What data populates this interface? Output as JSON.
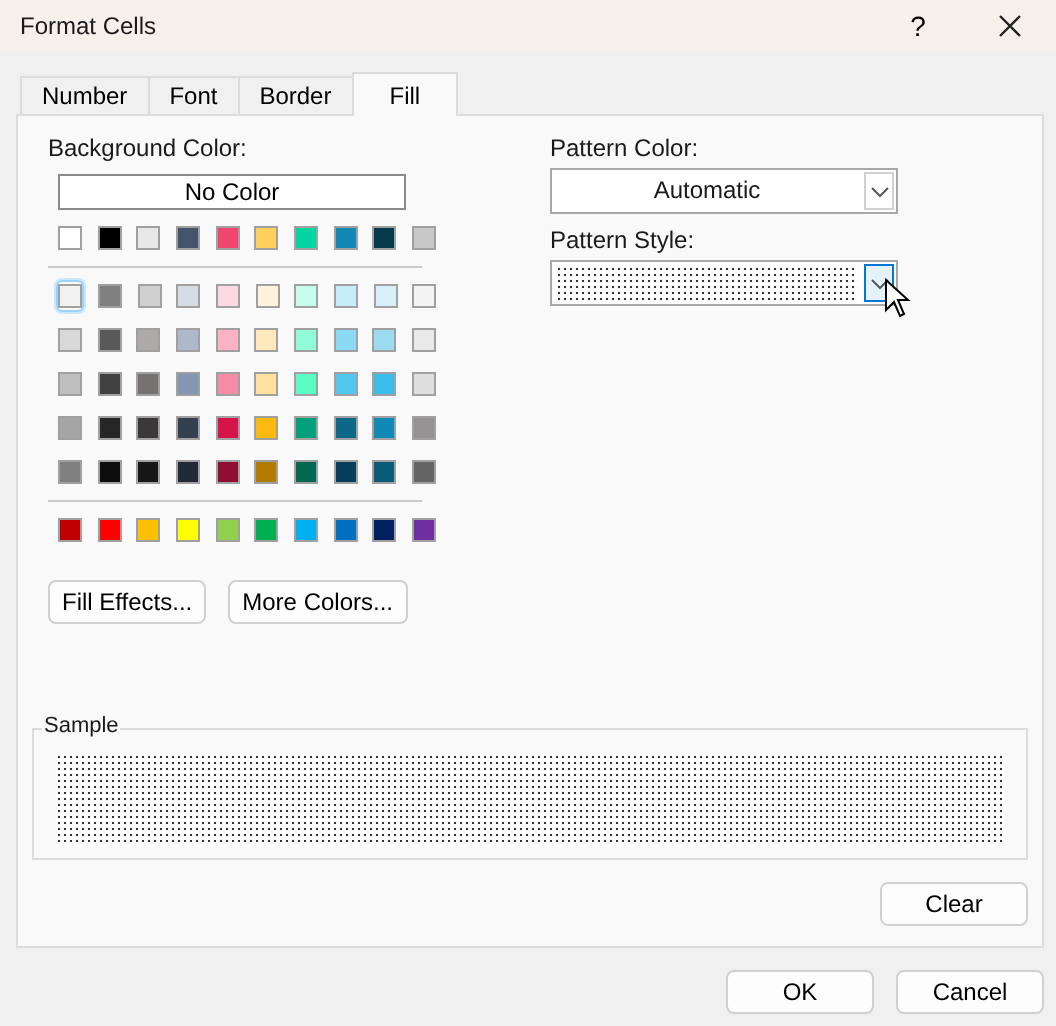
{
  "window": {
    "title": "Format Cells",
    "help_button": "?"
  },
  "tabs": [
    {
      "label": "Number",
      "selected": false
    },
    {
      "label": "Font",
      "selected": false
    },
    {
      "label": "Border",
      "selected": false
    },
    {
      "label": "Fill",
      "selected": true
    }
  ],
  "background_color": {
    "label": "Background Color:",
    "no_color_button": "No Color",
    "theme_colors": [
      {
        "color": "#ffffff",
        "selected": false
      },
      {
        "color": "#000000",
        "selected": false
      },
      {
        "color": "#e8e8e8",
        "selected": false
      },
      {
        "color": "#44546a",
        "selected": false
      },
      {
        "color": "#f0466e",
        "selected": false
      },
      {
        "color": "#ffd05c",
        "selected": false
      },
      {
        "color": "#00d4a0",
        "selected": false
      },
      {
        "color": "#1189b4",
        "selected": false
      },
      {
        "color": "#073a4a",
        "selected": false
      },
      {
        "color": "#c8c8c8",
        "selected": false
      }
    ],
    "shade_rows": [
      [
        {
          "color": "#f2f2f2",
          "selected": true
        },
        {
          "color": "#808080",
          "selected": false
        },
        {
          "color": "#d0d0d0",
          "selected": false
        },
        {
          "color": "#d6dce4",
          "selected": false
        },
        {
          "color": "#fcd9e2",
          "selected": false
        },
        {
          "color": "#fff3dc",
          "selected": false
        },
        {
          "color": "#c8fcec",
          "selected": false
        },
        {
          "color": "#c6edfa",
          "selected": false
        },
        {
          "color": "#d7f0fa",
          "selected": false
        },
        {
          "color": "#f4f4f4",
          "selected": false
        }
      ],
      [
        {
          "color": "#d9d9d9",
          "selected": false
        },
        {
          "color": "#595959",
          "selected": false
        },
        {
          "color": "#aeaaaa",
          "selected": false
        },
        {
          "color": "#adb9ca",
          "selected": false
        },
        {
          "color": "#f9b3c5",
          "selected": false
        },
        {
          "color": "#ffe8bd",
          "selected": false
        },
        {
          "color": "#91fad9",
          "selected": false
        },
        {
          "color": "#8cd9f3",
          "selected": false
        },
        {
          "color": "#9ddbf0",
          "selected": false
        },
        {
          "color": "#e9e9e9",
          "selected": false
        }
      ],
      [
        {
          "color": "#bfbfbf",
          "selected": false
        },
        {
          "color": "#404040",
          "selected": false
        },
        {
          "color": "#767171",
          "selected": false
        },
        {
          "color": "#8497b0",
          "selected": false
        },
        {
          "color": "#f68da8",
          "selected": false
        },
        {
          "color": "#ffe29f",
          "selected": false
        },
        {
          "color": "#5bfdc5",
          "selected": false
        },
        {
          "color": "#51c8ed",
          "selected": false
        },
        {
          "color": "#3cbce9",
          "selected": false
        },
        {
          "color": "#dedede",
          "selected": false
        }
      ],
      [
        {
          "color": "#a6a6a6",
          "selected": false
        },
        {
          "color": "#262626",
          "selected": false
        },
        {
          "color": "#3a3838",
          "selected": false
        },
        {
          "color": "#323f4f",
          "selected": false
        },
        {
          "color": "#d5144a",
          "selected": false
        },
        {
          "color": "#ffb810",
          "selected": false
        },
        {
          "color": "#00a07a",
          "selected": false
        },
        {
          "color": "#0d6787",
          "selected": false
        },
        {
          "color": "#1189b4",
          "selected": false
        },
        {
          "color": "#959393",
          "selected": false
        }
      ],
      [
        {
          "color": "#808080",
          "selected": false
        },
        {
          "color": "#0d0d0d",
          "selected": false
        },
        {
          "color": "#171717",
          "selected": false
        },
        {
          "color": "#222a35",
          "selected": false
        },
        {
          "color": "#8e0d31",
          "selected": false
        },
        {
          "color": "#b27c00",
          "selected": false
        },
        {
          "color": "#006a50",
          "selected": false
        },
        {
          "color": "#083f58",
          "selected": false
        },
        {
          "color": "#0c5a78",
          "selected": false
        },
        {
          "color": "#646464",
          "selected": false
        }
      ]
    ],
    "standard_colors": [
      {
        "color": "#c00000",
        "selected": false
      },
      {
        "color": "#ff0000",
        "selected": false
      },
      {
        "color": "#ffc000",
        "selected": false
      },
      {
        "color": "#ffff00",
        "selected": false
      },
      {
        "color": "#92d050",
        "selected": false
      },
      {
        "color": "#00b050",
        "selected": false
      },
      {
        "color": "#00b0f0",
        "selected": false
      },
      {
        "color": "#0070c0",
        "selected": false
      },
      {
        "color": "#002060",
        "selected": false
      },
      {
        "color": "#7030a0",
        "selected": false
      }
    ]
  },
  "fill_effects_button": "Fill Effects...",
  "more_colors_button": "More Colors...",
  "pattern_color": {
    "label": "Pattern Color:",
    "value": "Automatic"
  },
  "pattern_style": {
    "label": "Pattern Style:",
    "hovered": true
  },
  "sample": {
    "label": "Sample"
  },
  "clear_button": "Clear",
  "footer_buttons": [
    "OK",
    "Cancel"
  ]
}
